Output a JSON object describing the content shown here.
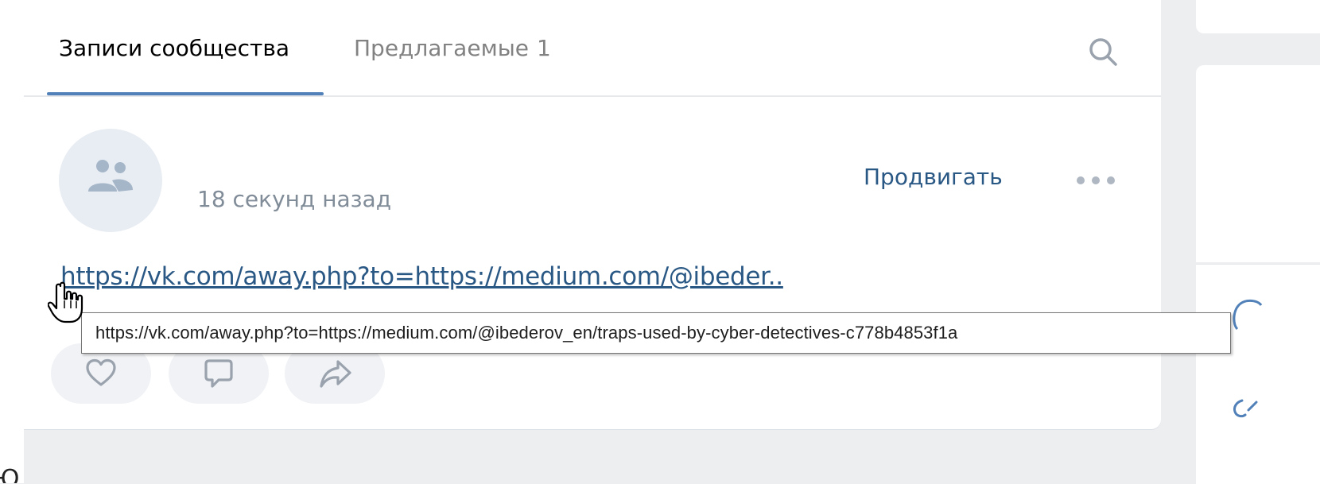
{
  "tabs": {
    "wall": "Записи сообщества",
    "suggested": "Предлагаемые",
    "suggested_count": "1"
  },
  "post": {
    "time": "18 секунд назад",
    "promote_label": "Продвигать",
    "link_text": "https://vk.com/away.php?to=https://medium.com/@ibeder.."
  },
  "tooltip": {
    "text": "https://vk.com/away.php?to=https://medium.com/@ibederov_en/traps-used-by-cyber-detectives-c778b4853f1a"
  },
  "icons": {
    "search": "search-icon",
    "avatar": "community-icon",
    "more": "more-icon",
    "like": "heart-icon",
    "comment": "comment-icon",
    "share": "share-icon",
    "cursor": "hand-cursor-icon"
  },
  "colors": {
    "accent": "#5181b8",
    "link": "#2a5885",
    "muted_text": "#818c99",
    "page_bg": "#edeef0"
  }
}
